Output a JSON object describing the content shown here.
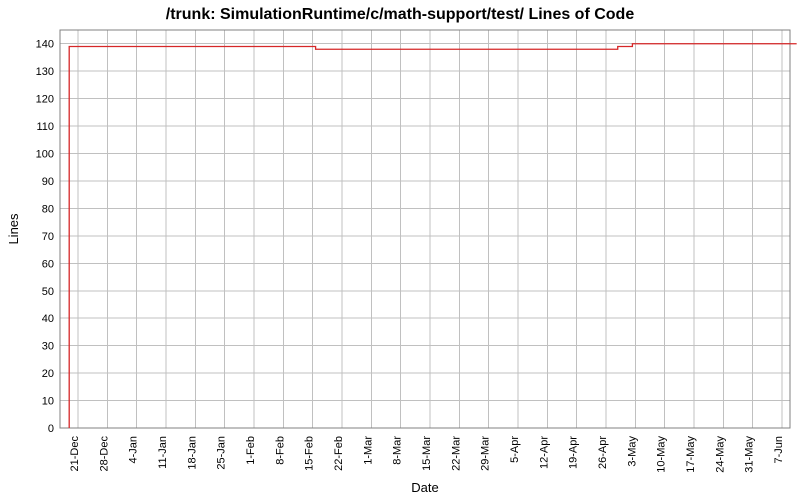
{
  "chart_data": {
    "type": "line",
    "title": "/trunk: SimulationRuntime/c/math-support/test/ Lines of Code",
    "xlabel": "Date",
    "ylabel": "Lines",
    "ylim": [
      0,
      145
    ],
    "y_ticks": [
      0,
      10,
      20,
      30,
      40,
      50,
      60,
      70,
      80,
      90,
      100,
      110,
      120,
      130,
      140
    ],
    "x_categories": [
      "21-Dec",
      "28-Dec",
      "4-Jan",
      "11-Jan",
      "18-Jan",
      "25-Jan",
      "1-Feb",
      "8-Feb",
      "15-Feb",
      "22-Feb",
      "1-Mar",
      "8-Mar",
      "15-Mar",
      "22-Mar",
      "29-Mar",
      "5-Apr",
      "12-Apr",
      "19-Apr",
      "26-Apr",
      "3-May",
      "10-May",
      "17-May",
      "24-May",
      "31-May",
      "7-Jun"
    ],
    "series": [
      {
        "name": "Lines of Code",
        "points": [
          {
            "x_index": -0.3,
            "y": 0
          },
          {
            "x_index": -0.3,
            "y": 139
          },
          {
            "x_index": 8.1,
            "y": 139
          },
          {
            "x_index": 8.1,
            "y": 138
          },
          {
            "x_index": 18.4,
            "y": 138
          },
          {
            "x_index": 18.4,
            "y": 139
          },
          {
            "x_index": 18.9,
            "y": 139
          },
          {
            "x_index": 18.9,
            "y": 140
          },
          {
            "x_index": 24.5,
            "y": 140
          }
        ]
      }
    ]
  }
}
